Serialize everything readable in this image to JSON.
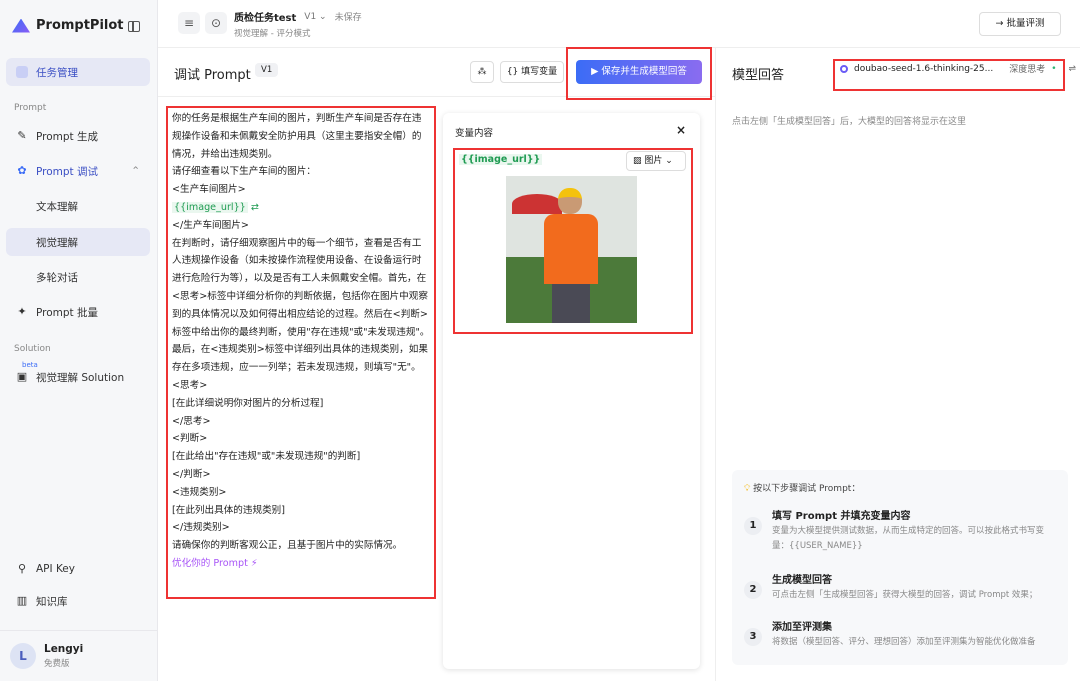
{
  "app": {
    "name": "PromptPilot"
  },
  "sidebar": {
    "task_mgmt": "任务管理",
    "section_prompt": "Prompt",
    "prompt_gen": "Prompt 生成",
    "prompt_debug": "Prompt 调试",
    "text_understanding": "文本理解",
    "vision_understanding": "视觉理解",
    "multi_turn": "多轮对话",
    "prompt_batch": "Prompt 批量",
    "section_solution": "Solution",
    "beta": "beta",
    "vision_solution": "视觉理解 Solution",
    "api_key": "API Key",
    "knowledge": "知识库",
    "user_name": "Lengyi",
    "user_initial": "L",
    "user_plan": "免费版"
  },
  "header": {
    "task_title": "质检任务test",
    "version": "V1",
    "save_status": "未保存",
    "mode": "视觉理解 - 评分模式",
    "batch_eval": "批量评测"
  },
  "debug": {
    "title": "调试 Prompt",
    "version": "V1",
    "fill_vars": "填写变量",
    "save_generate": "保存并生成模型回答",
    "prompt_lines": [
      "你的任务是根据生产车间的图片，判断生产车间是否存在违规操作设备和未佩戴安全防护用具（这里主要指安全帽）的情况，并给出违规类别。",
      "请仔细查看以下生产车间的图片：",
      "<生产车间图片>",
      "{{image_url}}",
      "</生产车间图片>",
      "在判断时，请仔细观察图片中的每一个细节，查看是否有工人违规操作设备（如未按操作流程使用设备、在设备运行时进行危险行为等），以及是否有工人未佩戴安全帽。首先，在<思考>标签中详细分析你的判断依据，包括你在图片中观察到的具体情况以及如何得出相应结论的过程。然后在<判断>标签中给出你的最终判断，使用\"存在违规\"或\"未发现违规\"。最后，在<违规类别>标签中详细列出具体的违规类别，如果存在多项违规，应一一列举；若未发现违规，则填写\"无\"。",
      "<思考>",
      "[在此详细说明你对图片的分析过程]",
      "</思考>",
      "<判断>",
      "[在此给出\"存在违规\"或\"未发现违规\"的判断]",
      "</判断>",
      "<违规类别>",
      "[在此列出具体的违规类别]",
      "</违规类别>",
      "请确保你的判断客观公正，且基于图片中的实际情况。"
    ],
    "optimize": "优化你的 Prompt"
  },
  "variables": {
    "title": "变量内容",
    "var_name": "{{image_url}}",
    "type": "图片"
  },
  "response": {
    "title": "模型回答",
    "model": "doubao-seed-1.6-thinking-25...",
    "deep_think": "深度思考",
    "placeholder": "点击左侧「生成模型回答」后，大模型的回答将显示在这里",
    "guide_title": "按以下步骤调试 Prompt：",
    "steps": [
      {
        "num": "1",
        "title": "填写 Prompt 并填充变量内容",
        "desc": "变量为大模型提供测试数据，从而生成特定的回答。可以按此格式书写变量：{{USER_NAME}}"
      },
      {
        "num": "2",
        "title": "生成模型回答",
        "desc": "可点击左侧「生成模型回答」获得大模型的回答，调试 Prompt 效果；"
      },
      {
        "num": "3",
        "title": "添加至评测集",
        "desc": "将数据（模型回答、评分、理想回答）添加至评测集为智能优化做准备"
      }
    ]
  },
  "colors": {
    "accent": "#3b6cf6",
    "highlight": "#e33333",
    "var_green": "#1f9b52"
  }
}
